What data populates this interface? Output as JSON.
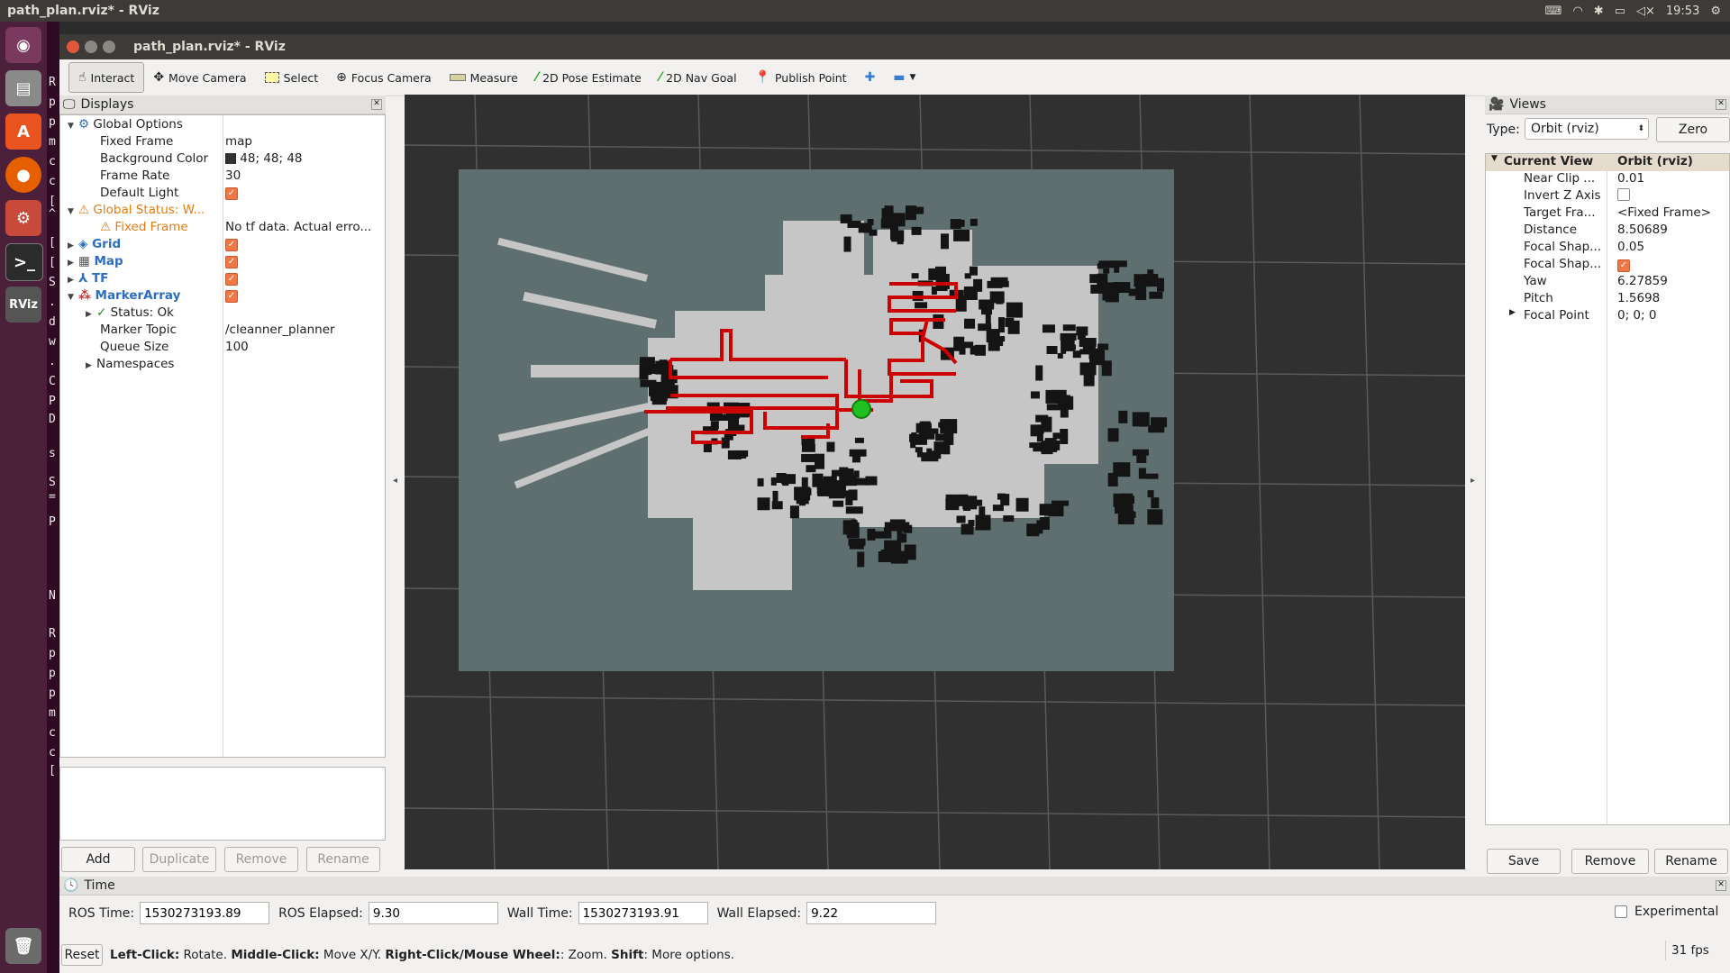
{
  "topbar": {
    "title": "path_plan.rviz* - RViz",
    "clock": "19:53"
  },
  "terminal_chars": [
    "R",
    "p",
    "p",
    "m",
    "c",
    "c",
    "[",
    "^",
    "[",
    "[",
    "S",
    ".",
    "d",
    "w",
    ".",
    "C",
    "P",
    "D",
    "s",
    "S",
    "=",
    "P",
    "N",
    "R",
    "p",
    "p",
    "p",
    "m",
    "c",
    "c",
    "["
  ],
  "window": {
    "title": "path_plan.rviz* - RViz"
  },
  "toolbar": {
    "interact": "Interact",
    "move_camera": "Move Camera",
    "select": "Select",
    "focus_camera": "Focus Camera",
    "measure": "Measure",
    "pose_estimate": "2D Pose Estimate",
    "nav_goal": "2D Nav Goal",
    "publish_point": "Publish Point"
  },
  "displays": {
    "title": "Displays",
    "rows": [
      {
        "label": "Global Options",
        "value": ""
      },
      {
        "label": "Fixed Frame",
        "value": "map"
      },
      {
        "label": "Background Color",
        "value": "48; 48; 48"
      },
      {
        "label": "Frame Rate",
        "value": "30"
      },
      {
        "label": "Default Light",
        "value": ""
      },
      {
        "label": "Global Status: W...",
        "value": ""
      },
      {
        "label": "Fixed Frame",
        "value": "No tf data.  Actual erro..."
      },
      {
        "label": "Grid",
        "value": ""
      },
      {
        "label": "Map",
        "value": ""
      },
      {
        "label": "TF",
        "value": ""
      },
      {
        "label": "MarkerArray",
        "value": ""
      },
      {
        "label": "Status: Ok",
        "value": ""
      },
      {
        "label": "Marker Topic",
        "value": "/cleanner_planner"
      },
      {
        "label": "Queue Size",
        "value": "100"
      },
      {
        "label": "Namespaces",
        "value": ""
      }
    ],
    "buttons": {
      "add": "Add",
      "duplicate": "Duplicate",
      "remove": "Remove",
      "rename": "Rename"
    }
  },
  "views": {
    "title": "Views",
    "type_label": "Type:",
    "type_value": "Orbit (rviz)",
    "zero": "Zero",
    "rows": [
      {
        "label": "Current View",
        "value": "Orbit (rviz)"
      },
      {
        "label": "Near Clip ...",
        "value": "0.01"
      },
      {
        "label": "Invert Z Axis",
        "value": ""
      },
      {
        "label": "Target Fra...",
        "value": "<Fixed Frame>"
      },
      {
        "label": "Distance",
        "value": "8.50689"
      },
      {
        "label": "Focal Shap...",
        "value": "0.05"
      },
      {
        "label": "Focal Shap...",
        "value": ""
      },
      {
        "label": "Yaw",
        "value": "6.27859"
      },
      {
        "label": "Pitch",
        "value": "1.5698"
      },
      {
        "label": "Focal Point",
        "value": "0; 0; 0"
      }
    ],
    "buttons": {
      "save": "Save",
      "remove": "Remove",
      "rename": "Rename"
    }
  },
  "time": {
    "title": "Time",
    "ros_time_label": "ROS Time:",
    "ros_time": "1530273193.89",
    "ros_elapsed_label": "ROS Elapsed:",
    "ros_elapsed": "9.30",
    "wall_time_label": "Wall Time:",
    "wall_time": "1530273193.91",
    "wall_elapsed_label": "Wall Elapsed:",
    "wall_elapsed": "9.22",
    "experimental": "Experimental"
  },
  "status": {
    "reset": "Reset",
    "left_click": "Left-Click:",
    "left_click_desc": " Rotate. ",
    "middle_click": "Middle-Click:",
    "middle_click_desc": " Move X/Y. ",
    "right_click": "Right-Click/Mouse Wheel:",
    "right_click_desc": ": Zoom. ",
    "shift": "Shift",
    "shift_desc": ": More options.",
    "fps": "31 fps"
  },
  "colors": {
    "background": "#303030",
    "path": "#cc0000",
    "robot": "#22cc22",
    "map_unknown": "#5e6e6e",
    "map_free": "#c8c8c8",
    "map_occupied": "#151515"
  }
}
